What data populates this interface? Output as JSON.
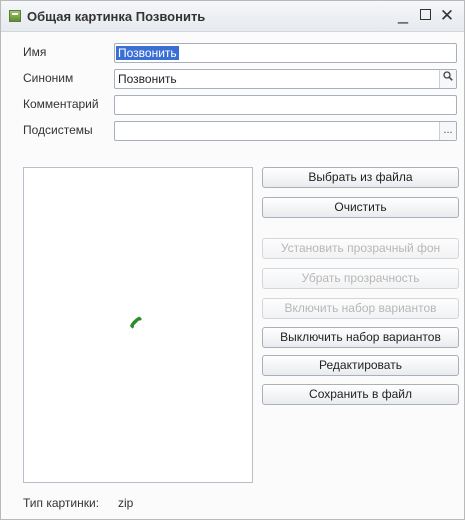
{
  "window": {
    "title": "Общая картинка Позвонить",
    "minimize": "_",
    "close": "✕"
  },
  "form": {
    "name_label": "Имя",
    "name_value": "Позвонить",
    "synonym_label": "Синоним",
    "synonym_value": "Позвонить",
    "comment_label": "Комментарий",
    "comment_value": "",
    "subsystems_label": "Подсистемы",
    "subsystems_value": "",
    "synonym_btn_icon": "magnifier-icon",
    "subsystems_btn": "..."
  },
  "preview": {
    "icon": "phone-handset-icon",
    "icon_color": "#2e8b2e"
  },
  "buttons": [
    {
      "label": "Выбрать из файла",
      "enabled": true
    },
    {
      "label": "Очистить",
      "enabled": true
    },
    {
      "label": "Установить прозрачный фон",
      "enabled": false
    },
    {
      "label": "Убрать прозрачность",
      "enabled": false
    },
    {
      "label": "Включить набор вариантов",
      "enabled": false
    },
    {
      "label": "Выключить набор вариантов",
      "enabled": true
    },
    {
      "label": "Редактировать",
      "enabled": true
    },
    {
      "label": "Сохранить в файл",
      "enabled": true
    }
  ],
  "footer": {
    "type_label": "Тип картинки:",
    "type_value": "zip"
  }
}
